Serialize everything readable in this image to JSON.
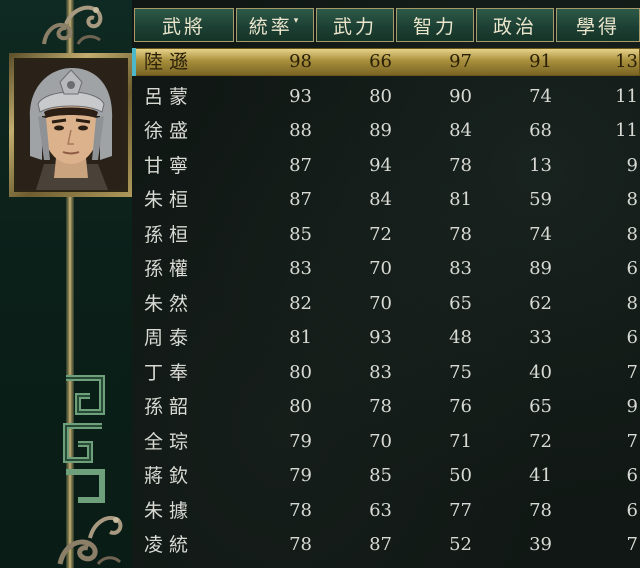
{
  "colors": {
    "header_bg": "#1d4034",
    "header_border": "#a79b6c",
    "selected_row": "#c8b05a",
    "text": "#d8dad3"
  },
  "icons": {
    "portrait": "general-portrait-lu-xun",
    "ornament": "dragon-ornament-icon"
  },
  "table": {
    "headers": [
      {
        "label": "武將",
        "sorted": false
      },
      {
        "label": "統率",
        "sorted": true,
        "sort_mark": "▾"
      },
      {
        "label": "武力",
        "sorted": false
      },
      {
        "label": "智力",
        "sorted": false
      },
      {
        "label": "政治",
        "sorted": false
      },
      {
        "label": "學得",
        "sorted": false
      }
    ],
    "selected_index": 0,
    "rows": [
      {
        "name": "陸遜",
        "tongshuai": "98",
        "wuli": "66",
        "zhili": "97",
        "zhengzhi": "91",
        "xuede": "13"
      },
      {
        "name": "呂蒙",
        "tongshuai": "93",
        "wuli": "80",
        "zhili": "90",
        "zhengzhi": "74",
        "xuede": "11"
      },
      {
        "name": "徐盛",
        "tongshuai": "88",
        "wuli": "89",
        "zhili": "84",
        "zhengzhi": "68",
        "xuede": "11"
      },
      {
        "name": "甘寧",
        "tongshuai": "87",
        "wuli": "94",
        "zhili": "78",
        "zhengzhi": "13",
        "xuede": "9"
      },
      {
        "name": "朱桓",
        "tongshuai": "87",
        "wuli": "84",
        "zhili": "81",
        "zhengzhi": "59",
        "xuede": "8"
      },
      {
        "name": "孫桓",
        "tongshuai": "85",
        "wuli": "72",
        "zhili": "78",
        "zhengzhi": "74",
        "xuede": "8"
      },
      {
        "name": "孫權",
        "tongshuai": "83",
        "wuli": "70",
        "zhili": "83",
        "zhengzhi": "89",
        "xuede": "6"
      },
      {
        "name": "朱然",
        "tongshuai": "82",
        "wuli": "70",
        "zhili": "65",
        "zhengzhi": "62",
        "xuede": "8"
      },
      {
        "name": "周泰",
        "tongshuai": "81",
        "wuli": "93",
        "zhili": "48",
        "zhengzhi": "33",
        "xuede": "6"
      },
      {
        "name": "丁奉",
        "tongshuai": "80",
        "wuli": "83",
        "zhili": "75",
        "zhengzhi": "40",
        "xuede": "7"
      },
      {
        "name": "孫韶",
        "tongshuai": "80",
        "wuli": "78",
        "zhili": "76",
        "zhengzhi": "65",
        "xuede": "9"
      },
      {
        "name": "全琮",
        "tongshuai": "79",
        "wuli": "70",
        "zhili": "71",
        "zhengzhi": "72",
        "xuede": "7"
      },
      {
        "name": "蔣欽",
        "tongshuai": "79",
        "wuli": "85",
        "zhili": "50",
        "zhengzhi": "41",
        "xuede": "6"
      },
      {
        "name": "朱據",
        "tongshuai": "78",
        "wuli": "63",
        "zhili": "77",
        "zhengzhi": "78",
        "xuede": "6"
      },
      {
        "name": "凌統",
        "tongshuai": "78",
        "wuli": "87",
        "zhili": "52",
        "zhengzhi": "39",
        "xuede": "7"
      }
    ]
  }
}
